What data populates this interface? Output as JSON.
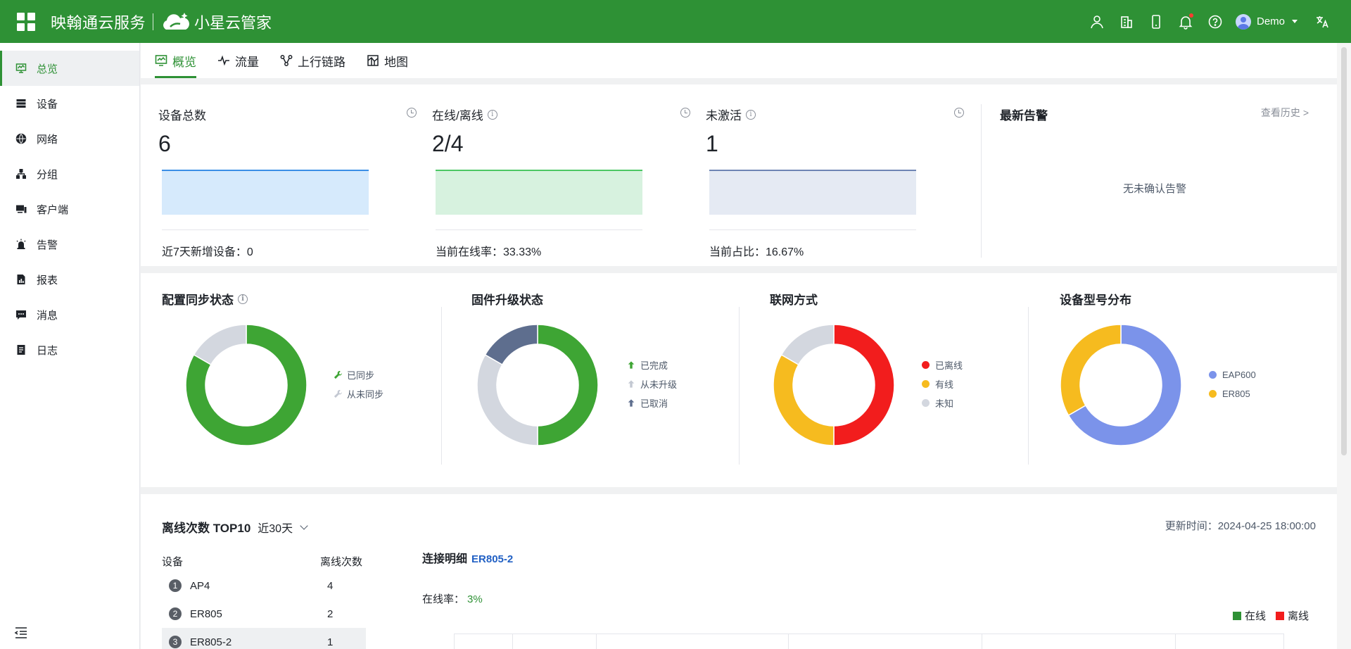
{
  "header": {
    "brand": "映翰通云服务",
    "product": "小星云管家",
    "user": "Demo",
    "icons": [
      "user-manage-icon",
      "building-icon",
      "mobile-icon",
      "bell-icon",
      "help-icon",
      "translate-icon"
    ]
  },
  "sidebar": {
    "items": [
      {
        "label": "总览",
        "icon": "monitor-icon",
        "active": true
      },
      {
        "label": "设备",
        "icon": "server-icon"
      },
      {
        "label": "网络",
        "icon": "globe-icon"
      },
      {
        "label": "分组",
        "icon": "hierarchy-icon"
      },
      {
        "label": "客户端",
        "icon": "client-icon"
      },
      {
        "label": "告警",
        "icon": "alarm-light-icon"
      },
      {
        "label": "报表",
        "icon": "report-icon"
      },
      {
        "label": "消息",
        "icon": "message-icon"
      },
      {
        "label": "日志",
        "icon": "log-icon"
      }
    ]
  },
  "tabs": [
    {
      "label": "概览",
      "active": true
    },
    {
      "label": "流量"
    },
    {
      "label": "上行链路"
    },
    {
      "label": "地图"
    }
  ],
  "summary": {
    "total": {
      "title": "设备总数",
      "value": "6",
      "footer": "近7天新增设备：0",
      "color": "#3a8ee6",
      "fill": "#d6eafc"
    },
    "online": {
      "title": "在线/离线",
      "value": "2/4",
      "footer": "当前在线率：33.33%",
      "color": "#4cc764",
      "fill": "#d7f2df"
    },
    "inactive": {
      "title": "未激活",
      "value": "1",
      "footer": "当前占比：16.67%",
      "color": "#6e84b4",
      "fill": "#e5eaf3"
    }
  },
  "alarms": {
    "title": "最新告警",
    "history_link": "查看历史",
    "empty": "无未确认告警"
  },
  "donuts": {
    "config_sync": {
      "title": "配置同步状态",
      "legend": [
        "已同步",
        "从未同步"
      ],
      "values": [
        5,
        1
      ],
      "colors": [
        "#3ea534",
        "#d3d7df"
      ]
    },
    "firmware": {
      "title": "固件升级状态",
      "legend": [
        "已完成",
        "从未升级",
        "已取消"
      ],
      "values": [
        3,
        2,
        1
      ],
      "colors": [
        "#3ea534",
        "#d3d7df",
        "#5e6e8e"
      ]
    },
    "network": {
      "title": "联网方式",
      "legend": [
        "已离线",
        "有线",
        "未知"
      ],
      "values": [
        3,
        2,
        1
      ],
      "colors": [
        "#f21d1d",
        "#f6bb1f",
        "#d3d7df"
      ]
    },
    "models": {
      "title": "设备型号分布",
      "legend": [
        "EAP600",
        "ER805"
      ],
      "values": [
        4,
        2
      ],
      "colors": [
        "#7b93ea",
        "#f6bb1f"
      ]
    }
  },
  "offline_top": {
    "title": "离线次数 TOP10",
    "range": "近30天",
    "updated": "更新时间：2024-04-25 18:00:00",
    "columns": [
      "设备",
      "离线次数"
    ],
    "rows": [
      {
        "rank": "1",
        "device": "AP4",
        "count": "4"
      },
      {
        "rank": "2",
        "device": "ER805",
        "count": "2"
      },
      {
        "rank": "3",
        "device": "ER805-2",
        "count": "1"
      }
    ],
    "connection_label": "连接明细",
    "connection_device": "ER805-2",
    "online_rate_label": "在线率：",
    "online_rate": "3%",
    "legend": [
      {
        "label": "在线",
        "color": "#2e9135"
      },
      {
        "label": "离线",
        "color": "#f21d1d"
      }
    ]
  }
}
